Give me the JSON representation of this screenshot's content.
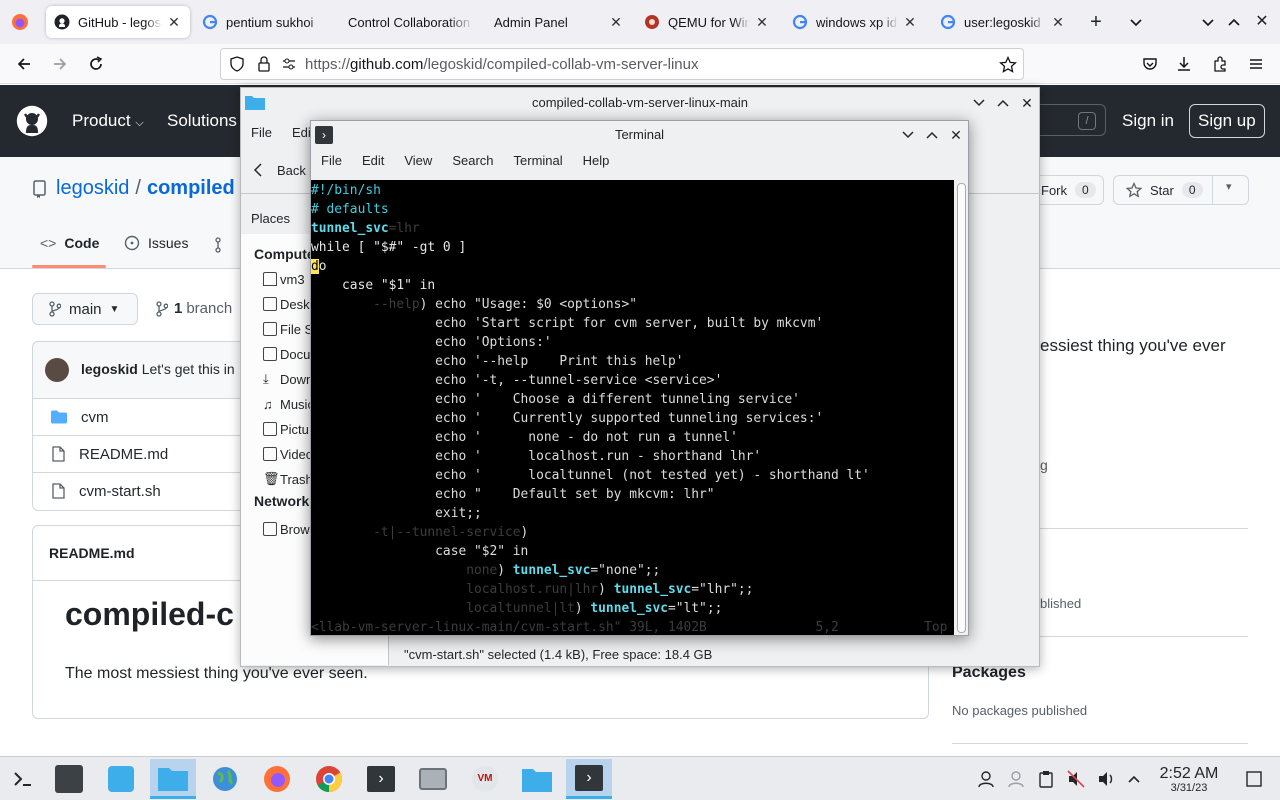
{
  "browser": {
    "tabs": [
      {
        "label": "GitHub - legoskid/compiled-collab-vm-server-linux",
        "icon": "github-icon",
        "active": true
      },
      {
        "label": "pentium sukhoi",
        "icon": "google-icon"
      },
      {
        "label": "Control Collaboration",
        "icon": "none"
      },
      {
        "label": "Admin Panel",
        "icon": "none"
      },
      {
        "label": "QEMU for Windows",
        "icon": "qemu-icon"
      },
      {
        "label": "windows xp iden",
        "icon": "google-icon"
      },
      {
        "label": "user:legoskid",
        "icon": "google-icon"
      }
    ],
    "url": {
      "prefix": "https://",
      "host": "github.com",
      "path": "/legoskid/compiled-collab-vm-server-linux"
    }
  },
  "github": {
    "nav": [
      "Product",
      "Solutions"
    ],
    "sign_in": "Sign in",
    "sign_up": "Sign up",
    "search_key": "/",
    "owner": "legoskid",
    "sep": "/",
    "repo": "compiled",
    "fork_label": "Fork",
    "fork_count": "0",
    "star_label": "Star",
    "star_count": "0",
    "tabs": {
      "code": "Code",
      "issues": "Issues"
    },
    "branch": "main",
    "branch_count": "1",
    "branch_word": "branch",
    "commit_author": "legoskid",
    "commit_msg": "Let's get this in",
    "files": [
      "cvm",
      "README.md",
      "cvm-start.sh"
    ],
    "readme_header": "README.md",
    "readme_title": "compiled-c",
    "readme_desc": "The most messiest thing you've ever seen.",
    "about_desc": "essiest thing you've ever",
    "about_partial1": "g",
    "about_partial2": "blished",
    "packages_title": "Packages",
    "packages_none": "No packages published"
  },
  "file_manager": {
    "title": "compiled-collab-vm-server-linux-main",
    "menu": [
      "File",
      "Edi"
    ],
    "back_label": "Back",
    "places_title": "Places",
    "computer_label": "Compute",
    "places": [
      "vm3",
      "Deskt",
      "File S",
      "Docu",
      "Down",
      "Music",
      "Pictu",
      "Videc",
      "Trash"
    ],
    "network_label": "Network",
    "network_items": [
      "Brow"
    ],
    "status": "\"cvm-start.sh\" selected (1.4 kB), Free space: 18.4 GB"
  },
  "terminal": {
    "title": "Terminal",
    "menu": [
      "File",
      "Edit",
      "View",
      "Search",
      "Terminal",
      "Help"
    ],
    "lines": [
      [
        {
          "t": "#!/bin/sh",
          "c": "cmt"
        }
      ],
      [
        {
          "t": "# defaults",
          "c": "cmt"
        }
      ],
      [
        {
          "t": "tunnel_svc",
          "c": "var"
        },
        {
          "t": "=lhr",
          "c": "dim"
        }
      ],
      [
        {
          "t": "while [ \"$#\" -gt 0 ]",
          "c": "kw"
        }
      ],
      [
        {
          "t": "d",
          "c": "cursor"
        },
        {
          "t": "o",
          "c": "kw"
        }
      ],
      [
        {
          "t": "    case \"$1\" in",
          "c": "kw"
        }
      ],
      [
        {
          "t": "        --help",
          "c": "dim"
        },
        {
          "t": ") echo \"Usage: $0 <options>\"",
          "c": "str"
        }
      ],
      [
        {
          "t": "                echo 'Start script for cvm server, built by mkcvm'",
          "c": "str"
        }
      ],
      [
        {
          "t": "                echo 'Options:'",
          "c": "str"
        }
      ],
      [
        {
          "t": "                echo '--help    Print this help'",
          "c": "str"
        }
      ],
      [
        {
          "t": "                echo '-t, --tunnel-service <service>'",
          "c": "str"
        }
      ],
      [
        {
          "t": "                echo '    Choose a different tunneling service'",
          "c": "str"
        }
      ],
      [
        {
          "t": "                echo '    Currently supported tunneling services:'",
          "c": "str"
        }
      ],
      [
        {
          "t": "                echo '      none - do not run a tunnel'",
          "c": "str"
        }
      ],
      [
        {
          "t": "                echo '      localhost.run - shorthand lhr'",
          "c": "str"
        }
      ],
      [
        {
          "t": "                echo '      localtunnel (not tested yet) - shorthand lt'",
          "c": "str"
        }
      ],
      [
        {
          "t": "                echo \"    Default set by mkcvm: lhr\"",
          "c": "str"
        }
      ],
      [
        {
          "t": "                exit;;",
          "c": "str"
        }
      ],
      [
        {
          "t": "        -t|--tunnel-service",
          "c": "dim"
        },
        {
          "t": ")",
          "c": "str"
        }
      ],
      [
        {
          "t": "                case \"$2\" in",
          "c": "str"
        }
      ],
      [
        {
          "t": "                    none",
          "c": "dim"
        },
        {
          "t": ") ",
          "c": "str"
        },
        {
          "t": "tunnel_svc",
          "c": "var"
        },
        {
          "t": "=\"none\";;",
          "c": "str"
        }
      ],
      [
        {
          "t": "                    localhost.run|lhr",
          "c": "dim"
        },
        {
          "t": ") ",
          "c": "str"
        },
        {
          "t": "tunnel_svc",
          "c": "var"
        },
        {
          "t": "=\"lhr\";;",
          "c": "str"
        }
      ],
      [
        {
          "t": "                    localtunnel|lt",
          "c": "dim"
        },
        {
          "t": ") ",
          "c": "str"
        },
        {
          "t": "tunnel_svc",
          "c": "var"
        },
        {
          "t": "=\"lt\";;",
          "c": "str"
        }
      ],
      [
        {
          "t": "<llab-vm-server-linux-main/cvm-start.sh\" 39L, 1402B              5,2           Top",
          "c": "dim"
        }
      ]
    ]
  },
  "taskbar": {
    "apps": [
      "app-launcher",
      "system-settings",
      "discover-store",
      "file-manager",
      "globe-browser",
      "firefox",
      "chrome",
      "terminal",
      "printer",
      "virtualbox",
      "folder",
      "terminal-active"
    ],
    "time": "2:52 AM",
    "date": "3/31/23"
  },
  "colors": {
    "github_header": "#24292f",
    "terminal_bg": "#000000",
    "accent": "#3daee9",
    "cursor": "#ffe45c"
  }
}
